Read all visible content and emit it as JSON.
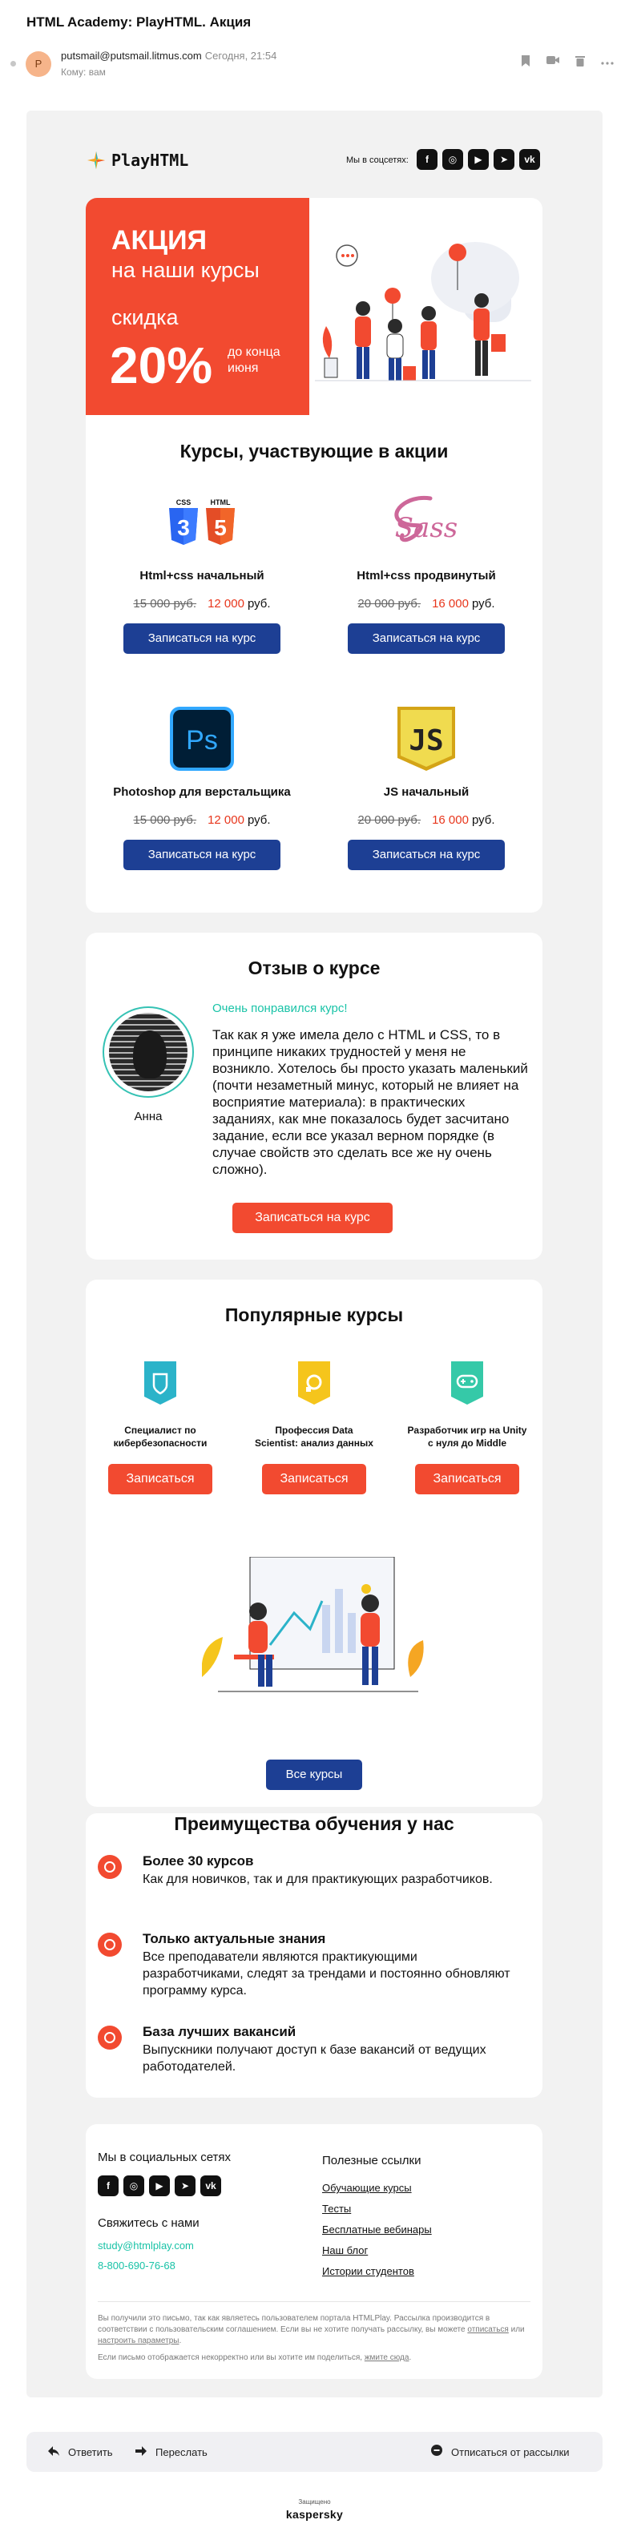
{
  "mail": {
    "subject": "HTML Academy: PlayHTML. Акция",
    "avatar_letter": "P",
    "sender": "putsmail@putsmail.litmus.com",
    "date": "Сегодня, 21:54",
    "to": "Кому: вам"
  },
  "header_icons": [
    "bookmark-icon",
    "video-icon",
    "trash-icon",
    "more-icon"
  ],
  "brand": {
    "logo": "PlayHTML",
    "social_caption": "Мы в соцсетях:",
    "social": [
      "VK",
      "Telegram",
      "YouTube",
      "Instagram",
      "Facebook"
    ]
  },
  "hero": {
    "line1": "АКЦИЯ",
    "line2": "на наши курсы",
    "line3": "скидка",
    "percent": "20%",
    "note": "до конца июня",
    "accent": "#f24a30"
  },
  "courses": {
    "title": "Курсы, участвующие в акции",
    "currency": "руб.",
    "button": "Записаться на курс",
    "items": [
      {
        "name": "Html+css начальный",
        "old": "15 000 руб.",
        "new": "12 000",
        "icons": [
          "css3-icon",
          "html5-icon"
        ]
      },
      {
        "name": "Html+css продвинутый",
        "old": "20 000 руб.",
        "new": "16 000",
        "icons": [
          "sass-icon"
        ]
      },
      {
        "name": "Photoshop для верстальщика",
        "old": "15 000 руб.",
        "new": "12 000",
        "icons": [
          "photoshop-icon"
        ]
      },
      {
        "name": "JS начальный",
        "old": "20 000 руб.",
        "new": "16 000",
        "icons": [
          "javascript-icon"
        ]
      }
    ]
  },
  "review": {
    "title": "Отзыв о курсе",
    "headline": "Очень понравился курс!",
    "text": "Так как я уже имела дело с HTML и CSS, то в принципе никаких трудностей у меня не возникло. Хотелось бы просто указать маленький (почти незаметный минус, который не влияет на восприятие материала): в практических заданиях, как мне показалось будет засчитано задание, если все указал верном порядке (в случае свойств это сделать все же ну очень сложно).",
    "author": "Анна",
    "button": "Записаться на курс"
  },
  "popular": {
    "title": "Популярные курсы",
    "button": "Записаться",
    "items": [
      {
        "name": "Специалист по кибербезопасности",
        "color": "#2bb3c9"
      },
      {
        "name": "Профессия Data Scientist: анализ данных",
        "color": "#f5c51c"
      },
      {
        "name": "Разработчик игр на Unity с нуля до Middle",
        "color": "#35c9a8"
      }
    ],
    "all_button": "Все курсы"
  },
  "advantages": {
    "title": "Преимущества обучения у нас",
    "items": [
      {
        "title": "Более 30 курсов",
        "text": "Как для новичков, так и для практикующих разработчиков."
      },
      {
        "title": "Только актуальные знания",
        "text": "Все преподаватели являются практикующими разработчиками, следят за трендами и постоянно обновляют программу курса."
      },
      {
        "title": "База лучших вакансий",
        "text": "Выпускники получают доступ к базе вакансий от ведущих работодателей."
      }
    ]
  },
  "footer": {
    "social_title": "Мы в социальных сетях",
    "contact_title": "Свяжитесь с нами",
    "email": "study@htmlplay.com",
    "phone": "8-800-690-76-68",
    "links_title": "Полезные ссылки",
    "links": [
      "Обучающие курсы",
      "Тесты",
      "Бесплатные вебинары",
      "Наш блог",
      "Истории студентов"
    ],
    "legal1_pre": "Вы получили это письмо, так как являетесь пользователем портала HTMLPlay. Рассылка производится в соответствии с пользовательским соглашением. Если вы не хотите получать рассылку, вы можете ",
    "legal1_link1": "отписаться",
    "legal1_mid": " или ",
    "legal1_link2": "настроить параметры",
    "legal1_post": ".",
    "legal2_pre": "Если письмо отображается некорректно или вы хотите им поделиться, ",
    "legal2_link": "жмите сюда",
    "legal2_post": "."
  },
  "actions": {
    "reply": "Ответить",
    "forward": "Переслать",
    "unsubscribe": "Отписаться от рассылки"
  },
  "protection": {
    "caption": "Защищено",
    "brand": "kaspersky"
  }
}
